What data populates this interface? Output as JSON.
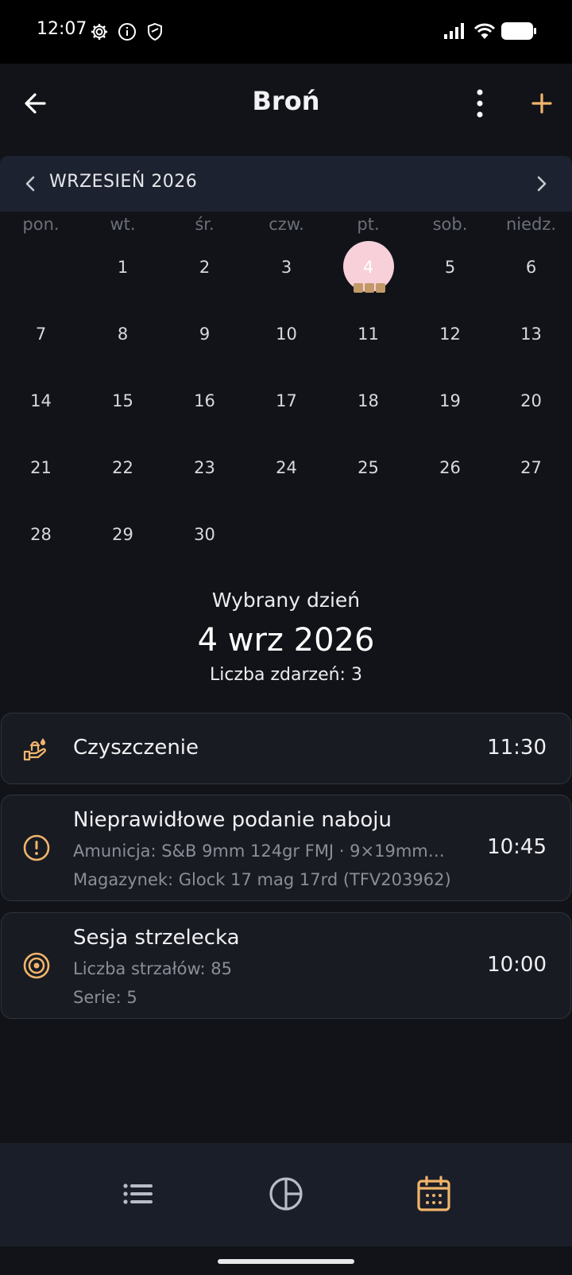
{
  "status_bar": {
    "time": "12:07",
    "icons": [
      "settings-icon",
      "info-icon",
      "shield-icon",
      "signal-icon",
      "wifi-icon",
      "battery-icon"
    ]
  },
  "app_bar": {
    "title": "Broń",
    "icons": [
      "arrow-back-icon",
      "more-vert-icon",
      "add-icon"
    ]
  },
  "calendar": {
    "month": "WRZESIEŃ 2026",
    "weekdays": [
      "pon.",
      "wt.",
      "śr.",
      "czw.",
      "pt.",
      "sob.",
      "niedz."
    ],
    "weeks": [
      [
        "",
        "1",
        "2",
        "3",
        "4",
        "5",
        "6"
      ],
      [
        "7",
        "8",
        "9",
        "10",
        "11",
        "12",
        "13"
      ],
      [
        "14",
        "15",
        "16",
        "17",
        "18",
        "19",
        "20"
      ],
      [
        "21",
        "22",
        "23",
        "24",
        "25",
        "26",
        "27"
      ],
      [
        "28",
        "29",
        "30",
        "",
        "",
        "",
        ""
      ]
    ],
    "selected_day": "4",
    "selected_event_markers": 3
  },
  "selected": {
    "label": "Wybrany dzień",
    "date": "4 wrz 2026",
    "count": "Liczba zdarzeń: 3"
  },
  "events": [
    {
      "icon": "cleaning-hand-icon",
      "title": "Czyszczenie",
      "time": "11:30",
      "lines": []
    },
    {
      "icon": "alert-circle-icon",
      "title": "Nieprawidłowe podanie naboju",
      "time": "10:45",
      "lines": [
        "Amunicja: S&B 9mm 124gr FMJ  ·  9×19mm…",
        "Magazynek: Glock 17 mag 17rd (TFV203962)"
      ]
    },
    {
      "icon": "target-icon",
      "title": "Sesja strzelecka",
      "time": "10:00",
      "lines": [
        "Liczba strzałów: 85",
        "Serie: 5"
      ]
    }
  ],
  "bottom_nav": {
    "items": [
      "list-icon",
      "stats-icon",
      "calendar-icon"
    ],
    "active": "calendar-icon"
  },
  "colors": {
    "accent": "#f0b56b",
    "selected_day": "#f7d0da",
    "background": "#111318"
  }
}
